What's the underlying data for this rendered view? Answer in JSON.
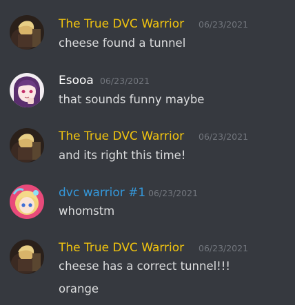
{
  "messages": [
    {
      "author": "The True DVC Warrior",
      "author_color": "#f1c40f",
      "timestamp": "06/23/2021",
      "avatar": "avatar-warrior-icon",
      "lines": [
        "cheese found a tunnel"
      ]
    },
    {
      "author": "Esooa",
      "author_color": "#ffffff",
      "timestamp": "06/23/2021",
      "avatar": "avatar-esooa-icon",
      "lines": [
        "that sounds funny maybe"
      ]
    },
    {
      "author": "The True DVC Warrior",
      "author_color": "#f1c40f",
      "timestamp": "06/23/2021",
      "avatar": "avatar-warrior-icon",
      "lines": [
        "and its right this time!"
      ]
    },
    {
      "author": "dvc warrior #1",
      "author_color": "#3498db",
      "timestamp": "06/23/2021",
      "avatar": "avatar-dvc-icon",
      "lines": [
        "whomstm"
      ]
    },
    {
      "author": "The True DVC Warrior",
      "author_color": "#f1c40f",
      "timestamp": "06/23/2021",
      "avatar": "avatar-warrior-icon",
      "lines": [
        "cheese has a correct tunnel!!!",
        "orange"
      ]
    }
  ]
}
